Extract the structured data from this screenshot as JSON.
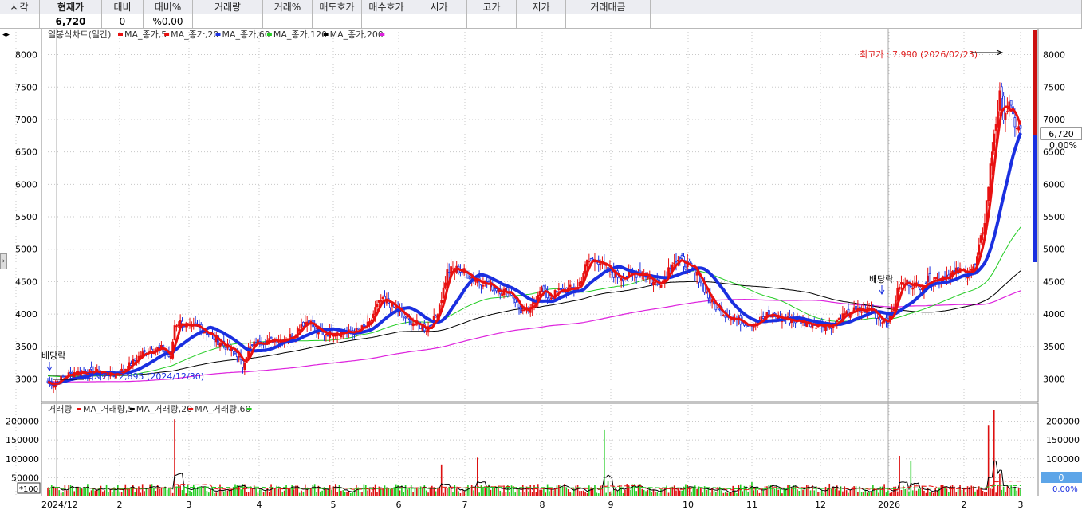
{
  "header": {
    "columns": [
      {
        "label": "시각",
        "value": ""
      },
      {
        "label": "현재가",
        "value": "6,720",
        "bold": true
      },
      {
        "label": "대비",
        "value": "0"
      },
      {
        "label": "대비%",
        "value": "%0.00"
      },
      {
        "label": "거래량",
        "value": ""
      },
      {
        "label": "거래%",
        "value": ""
      },
      {
        "label": "매도호가",
        "value": ""
      },
      {
        "label": "매수호가",
        "value": ""
      },
      {
        "label": "시가",
        "value": ""
      },
      {
        "label": "고가",
        "value": ""
      },
      {
        "label": "저가",
        "value": ""
      },
      {
        "label": "거래대금",
        "value": ""
      },
      {
        "label": "",
        "value": ""
      }
    ]
  },
  "price_panel": {
    "legend_title": "일봉식차트(일간)",
    "legend_items": [
      {
        "label": "MA_종가,5",
        "color": "#e81010"
      },
      {
        "label": "MA_종가,20",
        "color": "#e81010"
      },
      {
        "label": "MA_종가,60",
        "color": "#1a2fe0"
      },
      {
        "label": "MA_종가,120",
        "color": "#22cc22"
      },
      {
        "label": "MA_종가,200",
        "color": "#000000"
      }
    ],
    "legend_trailing_color": "#dd22dd",
    "y_ticks": [
      "8000",
      "7500",
      "7000",
      "6500",
      "6000",
      "5500",
      "5000",
      "4500",
      "4000",
      "3500",
      "3000"
    ],
    "annotations": {
      "high": "최고가 : 7,990 (2026/02/23)",
      "low": "최저가 : 2,895 (2024/12/30)",
      "dividend1": "배당락",
      "dividend2": "배당락"
    },
    "current_price_box": "6,720",
    "current_change_box": "0.00%"
  },
  "volume_panel": {
    "legend_title": "거래량",
    "legend_items": [
      {
        "label": "MA_거래량,5",
        "color": "#e81010"
      },
      {
        "label": "MA_거래량,20",
        "color": "#000000"
      },
      {
        "label": "MA_거래량,60",
        "color": "#e81010"
      }
    ],
    "legend_trailing_color": "#22cc22",
    "y_ticks": [
      "200000",
      "150000",
      "100000",
      "50000"
    ],
    "unit_label": "*100",
    "current_volume_box": "0",
    "current_volume_pct": "0.00%"
  },
  "x_ticks": [
    "2024/12",
    "2",
    "3",
    "4",
    "5",
    "6",
    "7",
    "8",
    "9",
    "10",
    "11",
    "12",
    "2026",
    "2",
    "3"
  ],
  "colors": {
    "up": "#e81010",
    "down": "#1a2fe0",
    "ma5": "#e81010",
    "ma20": "#1a2fe0",
    "ma60": "#22cc22",
    "ma120": "#000000",
    "ma200": "#dd22dd",
    "grid": "#c8c8c8"
  },
  "chart_data": {
    "type": "line",
    "title": "",
    "price_points": [
      [
        0,
        2950
      ],
      [
        3,
        2920
      ],
      [
        6,
        2990
      ],
      [
        10,
        3060
      ],
      [
        15,
        3110
      ],
      [
        20,
        3100
      ],
      [
        25,
        3110
      ],
      [
        30,
        3090
      ],
      [
        35,
        3060
      ],
      [
        40,
        3140
      ],
      [
        45,
        3260
      ],
      [
        50,
        3390
      ],
      [
        55,
        3450
      ],
      [
        60,
        3470
      ],
      [
        63,
        3380
      ],
      [
        65,
        3320
      ],
      [
        67,
        3830
      ],
      [
        70,
        3880
      ],
      [
        75,
        3780
      ],
      [
        80,
        3800
      ],
      [
        85,
        3700
      ],
      [
        90,
        3580
      ],
      [
        95,
        3480
      ],
      [
        100,
        3380
      ],
      [
        103,
        3200
      ],
      [
        106,
        3450
      ],
      [
        110,
        3560
      ],
      [
        115,
        3580
      ],
      [
        120,
        3600
      ],
      [
        125,
        3620
      ],
      [
        130,
        3680
      ],
      [
        134,
        3850
      ],
      [
        138,
        3900
      ],
      [
        142,
        3740
      ],
      [
        146,
        3700
      ],
      [
        150,
        3720
      ],
      [
        155,
        3730
      ],
      [
        160,
        3710
      ],
      [
        165,
        3760
      ],
      [
        170,
        3840
      ],
      [
        173,
        4080
      ],
      [
        176,
        4200
      ],
      [
        180,
        4180
      ],
      [
        185,
        4050
      ],
      [
        190,
        3920
      ],
      [
        195,
        3840
      ],
      [
        200,
        3770
      ],
      [
        205,
        3950
      ],
      [
        208,
        4250
      ],
      [
        211,
        4650
      ],
      [
        215,
        4700
      ],
      [
        220,
        4650
      ],
      [
        225,
        4550
      ],
      [
        230,
        4500
      ],
      [
        235,
        4420
      ],
      [
        240,
        4360
      ],
      [
        245,
        4320
      ],
      [
        250,
        4050
      ],
      [
        255,
        4050
      ],
      [
        260,
        4400
      ],
      [
        265,
        4250
      ],
      [
        270,
        4350
      ],
      [
        275,
        4380
      ],
      [
        280,
        4400
      ],
      [
        285,
        4800
      ],
      [
        290,
        4850
      ],
      [
        295,
        4700
      ],
      [
        300,
        4600
      ],
      [
        305,
        4580
      ],
      [
        310,
        4620
      ],
      [
        315,
        4650
      ],
      [
        320,
        4480
      ],
      [
        325,
        4520
      ],
      [
        330,
        4820
      ],
      [
        335,
        4800
      ],
      [
        340,
        4700
      ],
      [
        345,
        4520
      ],
      [
        350,
        4200
      ],
      [
        355,
        4050
      ],
      [
        360,
        3960
      ],
      [
        365,
        3900
      ],
      [
        370,
        3860
      ],
      [
        375,
        3880
      ],
      [
        380,
        3980
      ],
      [
        385,
        3960
      ],
      [
        390,
        3920
      ],
      [
        395,
        3900
      ],
      [
        400,
        3870
      ],
      [
        405,
        3850
      ],
      [
        410,
        3840
      ],
      [
        415,
        3830
      ],
      [
        420,
        3950
      ],
      [
        425,
        4050
      ],
      [
        430,
        4050
      ],
      [
        435,
        4080
      ],
      [
        440,
        3920
      ],
      [
        445,
        3920
      ],
      [
        450,
        4450
      ],
      [
        455,
        4490
      ],
      [
        460,
        4420
      ],
      [
        465,
        4520
      ],
      [
        470,
        4560
      ],
      [
        475,
        4600
      ],
      [
        480,
        4650
      ],
      [
        485,
        4660
      ],
      [
        490,
        4700
      ],
      [
        495,
        5450
      ],
      [
        500,
        6800
      ],
      [
        503,
        7350
      ],
      [
        505,
        7100
      ],
      [
        508,
        7200
      ],
      [
        511,
        6950
      ],
      [
        513,
        6850
      ]
    ],
    "volume_series_unit": "*100",
    "volume_spikes": [
      {
        "i": 67,
        "v": 205000
      },
      {
        "i": 45,
        "v": 30000
      },
      {
        "i": 294,
        "v": 178000
      },
      {
        "i": 208,
        "v": 85000
      },
      {
        "i": 227,
        "v": 103000
      },
      {
        "i": 296,
        "v": 40000
      },
      {
        "i": 372,
        "v": 38000
      },
      {
        "i": 450,
        "v": 108000
      },
      {
        "i": 456,
        "v": 95000
      },
      {
        "i": 497,
        "v": 190000
      },
      {
        "i": 500,
        "v": 230000
      },
      {
        "i": 503,
        "v": 60000
      }
    ],
    "price_ylim": [
      2650,
      8400
    ],
    "volume_ylim": [
      0,
      235000
    ],
    "yticks_price": [
      3000,
      3500,
      4000,
      4500,
      5000,
      5500,
      6000,
      6500,
      7000,
      7500,
      8000
    ],
    "yticks_volume": [
      50000,
      100000,
      150000,
      200000
    ]
  }
}
